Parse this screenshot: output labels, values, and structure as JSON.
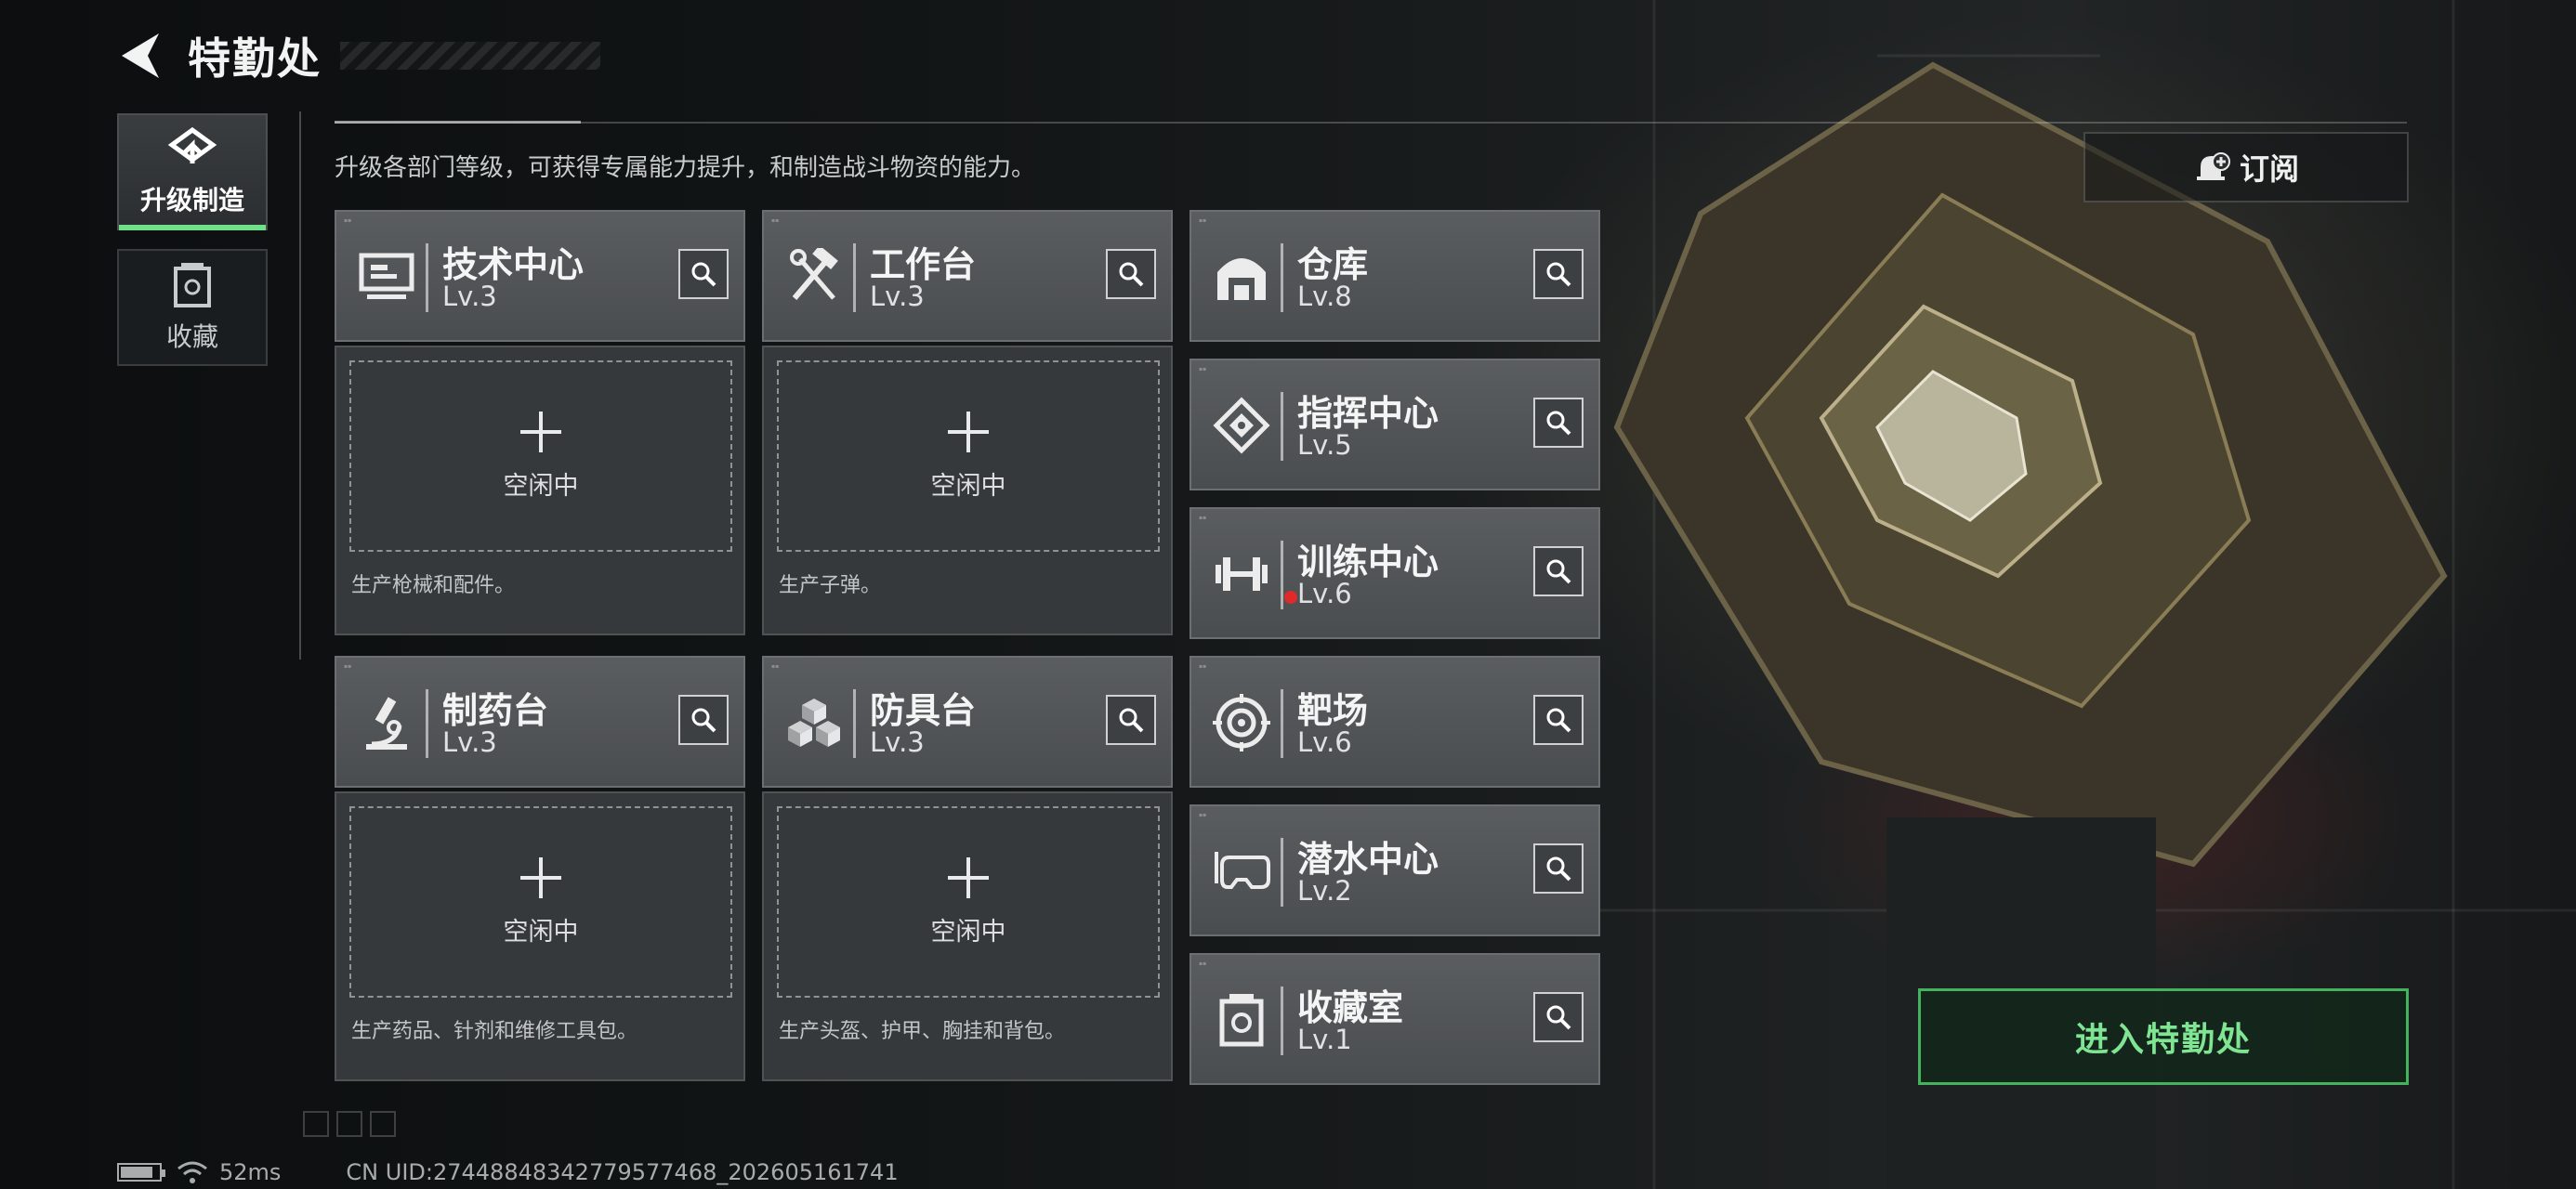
{
  "header": {
    "title": "特勤处"
  },
  "subtitle": "升级各部门等级，可获得专属能力提升，和制造战斗物资的能力。",
  "rail": {
    "upgrade_label": "升级制造",
    "collect_label": "收藏"
  },
  "subscribe": {
    "label": "订阅"
  },
  "modules": [
    {
      "name": "技术中心",
      "level": "Lv.3",
      "icon": "computer-icon"
    },
    {
      "name": "工作台",
      "level": "Lv.3",
      "icon": "hammer-wrench-icon"
    },
    {
      "name": "仓库",
      "level": "Lv.8",
      "icon": "warehouse-icon"
    },
    {
      "name": "指挥中心",
      "level": "Lv.5",
      "icon": "command-emblem-icon"
    },
    {
      "name": "训练中心",
      "level": "Lv.6",
      "icon": "dumbbell-icon",
      "alert": true
    },
    {
      "name": "制药台",
      "level": "Lv.3",
      "icon": "microscope-icon"
    },
    {
      "name": "防具台",
      "level": "Lv.3",
      "icon": "armor-cubes-icon"
    },
    {
      "name": "靶场",
      "level": "Lv.6",
      "icon": "target-icon"
    },
    {
      "name": "潜水中心",
      "level": "Lv.2",
      "icon": "diving-mask-icon"
    },
    {
      "name": "收藏室",
      "level": "Lv.1",
      "icon": "collection-case-icon"
    }
  ],
  "slots": [
    {
      "status": "空闲中",
      "desc": "生产枪械和配件。"
    },
    {
      "status": "空闲中",
      "desc": "生产子弹。"
    },
    {
      "status": "空闲中",
      "desc": "生产药品、针剂和维修工具包。"
    },
    {
      "status": "空闲中",
      "desc": "生产头盔、护甲、胸挂和背包。"
    }
  ],
  "enter_button": {
    "label": "进入特勤处"
  },
  "footer": {
    "ping": "52ms",
    "uid": "CN UID:27448848342779577468_202605161741"
  },
  "colors": {
    "accent_green": "#45b35d",
    "alert_red": "#e02a2a"
  }
}
